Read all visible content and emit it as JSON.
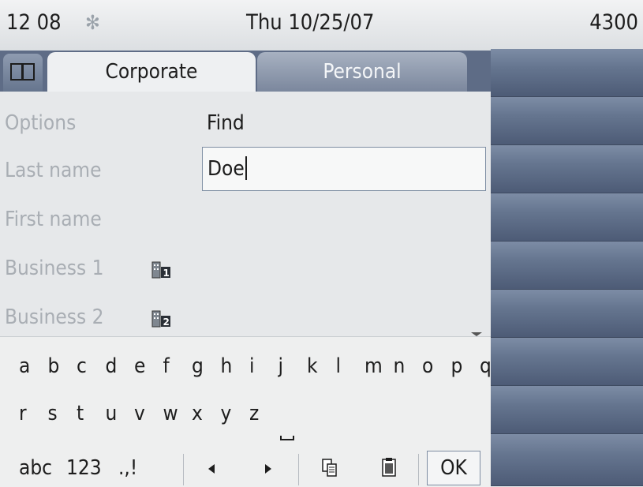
{
  "status_bar": {
    "time": "12 08",
    "date": "Thu 10/25/07",
    "extension": "4300",
    "bluetooth_icon": "bluetooth-icon"
  },
  "tabs": {
    "book_icon": "book-icon",
    "corporate": "Corporate",
    "personal": "Personal",
    "active": "Corporate"
  },
  "form": {
    "options_label": "Options",
    "options_value": "Find",
    "last_name_label": "Last name",
    "last_name_value": "Doe",
    "first_name_label": "First name",
    "business1_label": "Business 1",
    "business2_label": "Business 2",
    "business1_icon": "building-1-icon",
    "business2_icon": "building-2-icon"
  },
  "keyboard": {
    "row1": [
      "a",
      "b",
      "c",
      "d",
      "e",
      "f",
      "g",
      "h",
      "i",
      "j",
      "k",
      "l",
      "m",
      "n",
      "o",
      "p",
      "q"
    ],
    "row2": [
      "r",
      "s",
      "t",
      "u",
      "v",
      "w",
      "x",
      "y",
      "z"
    ],
    "space_icon": "space-icon",
    "mode_abc": "abc",
    "mode_123": "123",
    "mode_punct": ".,!",
    "left_icon": "arrow-left-icon",
    "right_icon": "arrow-right-icon",
    "copy_icon": "copy-icon",
    "paste_icon": "paste-icon",
    "ok": "OK"
  },
  "colors": {
    "softkey_panel": "#5a6a85",
    "tab_active": "#eef0f2",
    "label_gray": "#a9aeb4"
  }
}
